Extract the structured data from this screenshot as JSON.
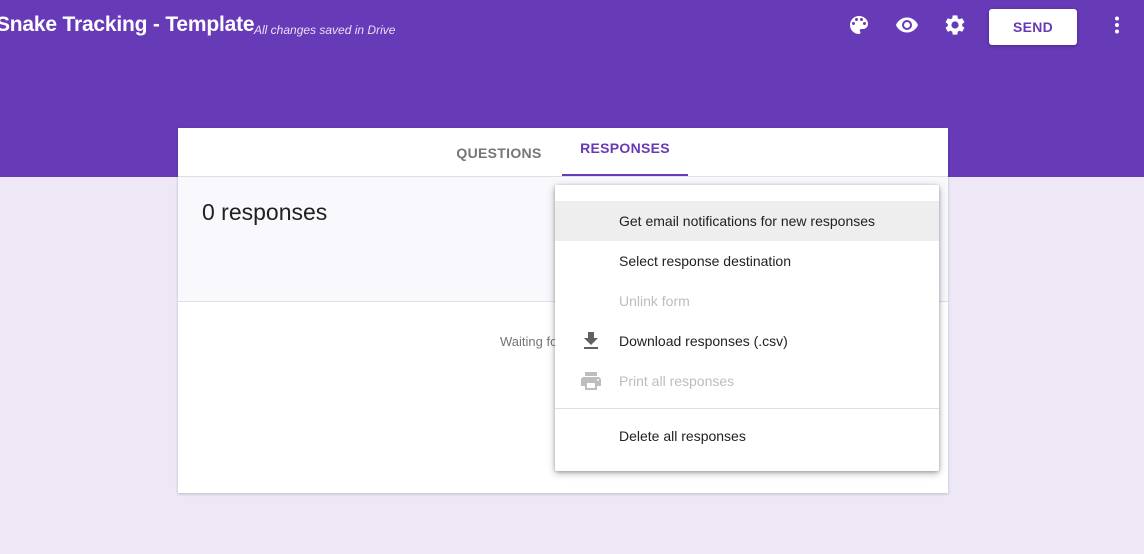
{
  "header": {
    "title": "Snake Tracking - Template",
    "save_status": "All changes saved in Drive",
    "send_label": "SEND",
    "icons": [
      "palette-icon",
      "eye-icon",
      "gear-icon",
      "more-vert-icon"
    ]
  },
  "tabs": [
    {
      "label": "QUESTIONS",
      "active": false
    },
    {
      "label": "RESPONSES",
      "active": true
    }
  ],
  "responses": {
    "count_label": "0 responses",
    "waiting_text": "Waiting fo"
  },
  "menu": {
    "items": [
      {
        "label": "Get email notifications for new responses",
        "icon": "",
        "disabled": false,
        "highlighted": true
      },
      {
        "label": "Select response destination",
        "icon": "",
        "disabled": false
      },
      {
        "label": "Unlink form",
        "icon": "",
        "disabled": true
      },
      {
        "label": "Download responses (.csv)",
        "icon": "download-icon",
        "disabled": false
      },
      {
        "label": "Print all responses",
        "icon": "print-icon",
        "disabled": true
      },
      {
        "label": "Delete all responses",
        "icon": "",
        "disabled": false
      }
    ]
  },
  "colors": {
    "accent": "#673ab7",
    "background": "#ede7f6",
    "disabled_text": "#bdbdbd"
  }
}
